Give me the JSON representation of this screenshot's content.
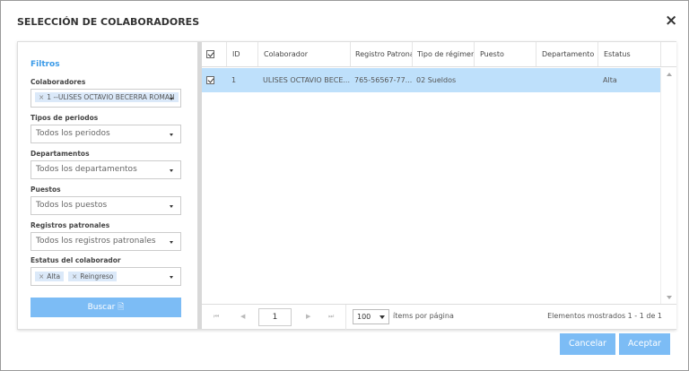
{
  "dialog": {
    "title": "SELECCIÓN DE COLABORADORES",
    "close_icon": "×"
  },
  "filters": {
    "heading": "Filtros",
    "colaboradores": {
      "label": "Colaboradores",
      "tags": [
        "1 --ULISES OCTAVIO BECERRA ROMAN"
      ]
    },
    "tipos_periodos": {
      "label": "Tipos de periodos",
      "value": "Todos los periodos"
    },
    "departamentos": {
      "label": "Departamentos",
      "value": "Todos los departamentos"
    },
    "puestos": {
      "label": "Puestos",
      "value": "Todos los puestos"
    },
    "registros": {
      "label": "Registros patronales",
      "value": "Todos los registros patronales"
    },
    "estatus": {
      "label": "Estatus del colaborador",
      "tags": [
        "Alta",
        "Reingreso"
      ]
    },
    "search_label": "Buscar"
  },
  "grid": {
    "columns": [
      "ID",
      "Colaborador",
      "Registro Patronal",
      "Tipo de régimen",
      "Puesto",
      "Departamento",
      "Estatus"
    ],
    "rows": [
      {
        "id": "1",
        "colaborador": "ULISES OCTAVIO BECE...",
        "registro": "765-56567-77...",
        "regimen": "02 Sueldos",
        "puesto": "",
        "departamento": "",
        "estatus": "Alta",
        "selected": true
      }
    ]
  },
  "pager": {
    "page": "1",
    "page_size": "100",
    "page_size_label": "ítems por página",
    "info": "Elementos mostrados 1 - 1 de 1"
  },
  "actions": {
    "cancel": "Cancelar",
    "accept": "Aceptar"
  }
}
